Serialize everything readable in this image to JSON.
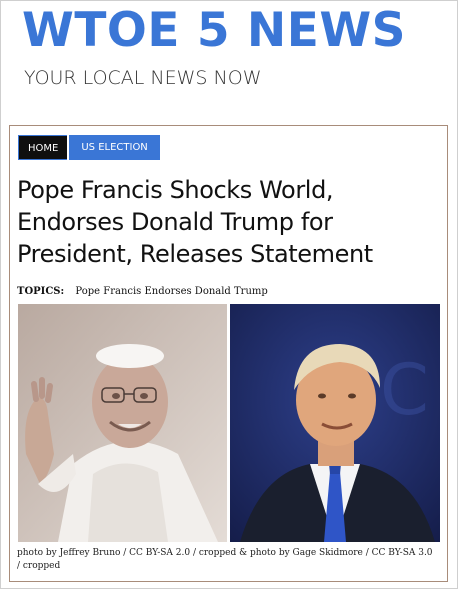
{
  "site": {
    "title": "WTOE 5 NEWS",
    "tagline": "YOUR LOCAL NEWS NOW",
    "brand_color": "#3a76d6"
  },
  "nav": {
    "home_label": "HOME",
    "election_label": "US ELECTION"
  },
  "article": {
    "headline": "Pope Francis Shocks World, Endorses Donald Trump for President, Releases Statement",
    "topics_label": "TOPICS:",
    "topic": "Pope Francis Endorses Donald Trump",
    "caption": "photo by Jeffrey Bruno / CC BY-SA 2.0 / cropped & photo by Gage Skidmore / CC BY-SA 3.0 / cropped"
  }
}
